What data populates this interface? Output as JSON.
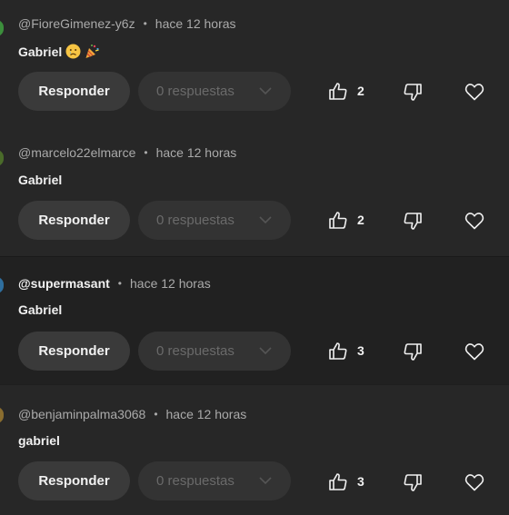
{
  "comments": [
    {
      "author": "@FioreGimenez-y6z",
      "separator": "•",
      "time": "hace 12 horas",
      "text": "Gabriel",
      "emojis": [
        "crying-face-emoji",
        "party-popper-emoji"
      ],
      "reply_label": "Responder",
      "replies_label": "0 respuestas",
      "likes": "2",
      "avatar_color": "#3c8f3c"
    },
    {
      "author": "@marcelo22elmarce",
      "separator": "•",
      "time": "hace 12 horas",
      "text": "Gabriel",
      "reply_label": "Responder",
      "replies_label": "0 respuestas",
      "likes": "2",
      "avatar_color": "#4a6b2a"
    },
    {
      "author": "@supermasant",
      "separator": "•",
      "time": "hace 12 horas",
      "text": "Gabriel",
      "reply_label": "Responder",
      "replies_label": "0 respuestas",
      "likes": "3",
      "avatar_color": "#2f6f9f"
    },
    {
      "author": "@benjaminpalma3068",
      "separator": "•",
      "time": "hace 12 horas",
      "text": "gabriel",
      "reply_label": "Responder",
      "replies_label": "0 respuestas",
      "likes": "3",
      "avatar_color": "#8a6d2f"
    }
  ],
  "colors": {
    "background": "#272727",
    "highlight_background": "#212121",
    "text": "#f1f1f1",
    "muted_text": "#aaaaaa",
    "button_bg": "#3a3a3a"
  }
}
